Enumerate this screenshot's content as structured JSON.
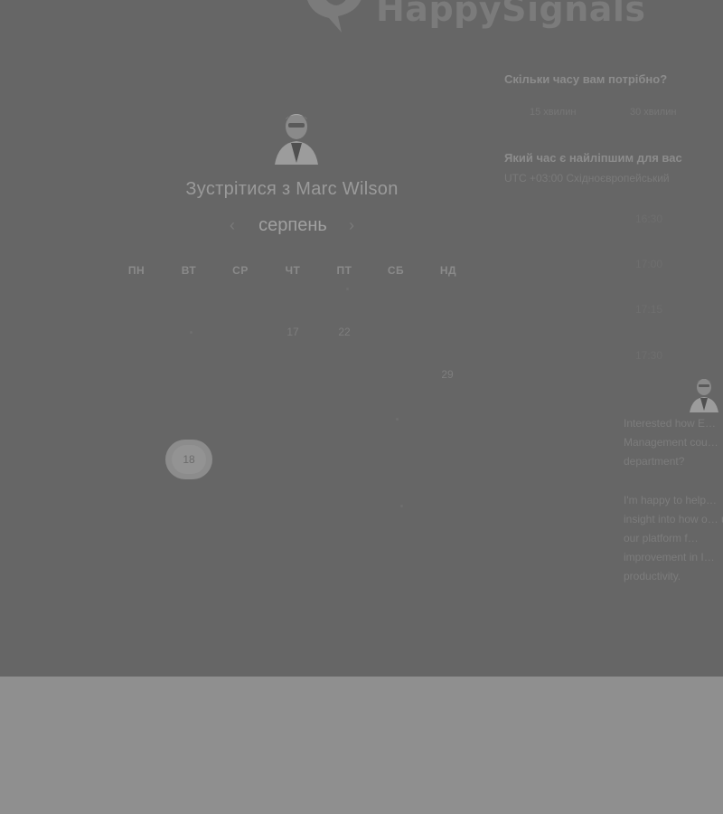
{
  "brand": {
    "name": "HappySignals"
  },
  "host": {
    "meeting_title": "Зустрітися з Marc Wilson"
  },
  "calendar": {
    "month": "серпень",
    "prev_icon": "‹",
    "next_icon": "›",
    "weekdays": [
      "ПН",
      "ВТ",
      "СР",
      "ЧТ",
      "ПТ",
      "СБ",
      "НД"
    ],
    "days": {
      "d17": "17",
      "d22": "22",
      "d29": "29",
      "selected": "18"
    }
  },
  "duration": {
    "question": "Скільки часу вам потрібно?",
    "options": [
      "15 хвилин",
      "30 хвилин"
    ]
  },
  "time": {
    "question": "Який час є найліпшим для вас",
    "timezone": "UTC +03:00 Східноєвропейський",
    "slots": [
      "16:30",
      "17:00",
      "17:15",
      "17:30"
    ]
  },
  "chat": {
    "paragraph1": "Interested how E… Management cou… department?",
    "paragraph2": "I'm happy to help… insight into how o… use our platform f… improvement in I… productivity."
  }
}
